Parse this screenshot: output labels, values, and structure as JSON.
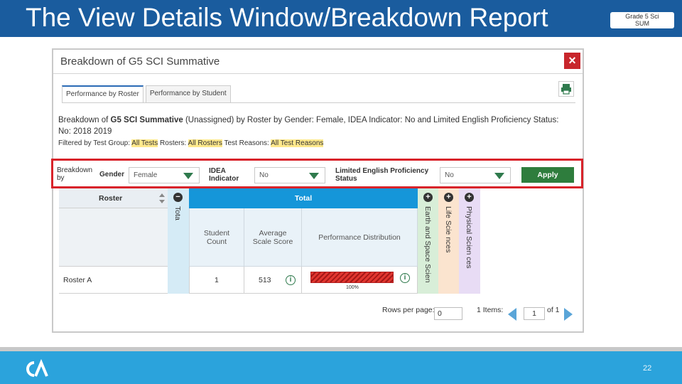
{
  "slide": {
    "title": "The View Details Window/Breakdown Report",
    "grade_badge_line1": "Grade 5 Sci",
    "grade_badge_line2": "SUM",
    "page_number": "22",
    "colors": {
      "header": "#1a5c9e",
      "footer": "#2ba3dc"
    }
  },
  "modal": {
    "title": "Breakdown of G5 SCI Summative",
    "close_glyph": "×",
    "tabs": [
      {
        "label": "Performance by Roster",
        "active": true
      },
      {
        "label": "Performance by Student",
        "active": false
      }
    ],
    "description": {
      "prefix": "Breakdown of ",
      "test_name": "G5 SCI Summative",
      "suffix": " (Unassigned) by Roster by Gender: Female, IDEA Indicator: No and Limited English Proficiency Status: No: 2018 2019"
    },
    "filtered": {
      "prefix": "Filtered by Test Group: ",
      "test_group": "All Tests",
      "rosters_label": " Rosters: ",
      "rosters": "All Rosters",
      "reasons_label": " Test Reasons: ",
      "reasons": "All Test Reasons"
    }
  },
  "breakdown_bar": {
    "breakdown_label_line1": "Breakdown",
    "breakdown_label_line2": "by",
    "gender_label": "Gender",
    "gender_value": "Female",
    "idea_label_line1": "IDEA",
    "idea_label_line2": "Indicator",
    "idea_value": "No",
    "lep_label_line1": "Limited English Proficiency",
    "lep_label_line2": "Status",
    "lep_value": "No",
    "apply_label": "Apply"
  },
  "table": {
    "roster_header": "Roster",
    "total_collapsed_label": "Tota",
    "total_header": "Total",
    "sub_headers": {
      "student_count_line1": "Student",
      "student_count_line2": "Count",
      "avg_score_line1": "Average",
      "avg_score_line2": "Scale Score",
      "perf_dist": "Performance Distribution"
    },
    "claims": [
      "Earth and Space Scien",
      "Life Scie nces",
      "Physical Scien ces"
    ],
    "rows": [
      {
        "roster": "Roster A",
        "student_count": "1",
        "avg_score": "513",
        "perf_percent": "100%"
      }
    ]
  },
  "pager": {
    "rows_per_page_label": "Rows per page:",
    "rows_per_page_value": "0",
    "items_label": "1 Items:",
    "page_value": "1",
    "of_label": "of 1"
  }
}
